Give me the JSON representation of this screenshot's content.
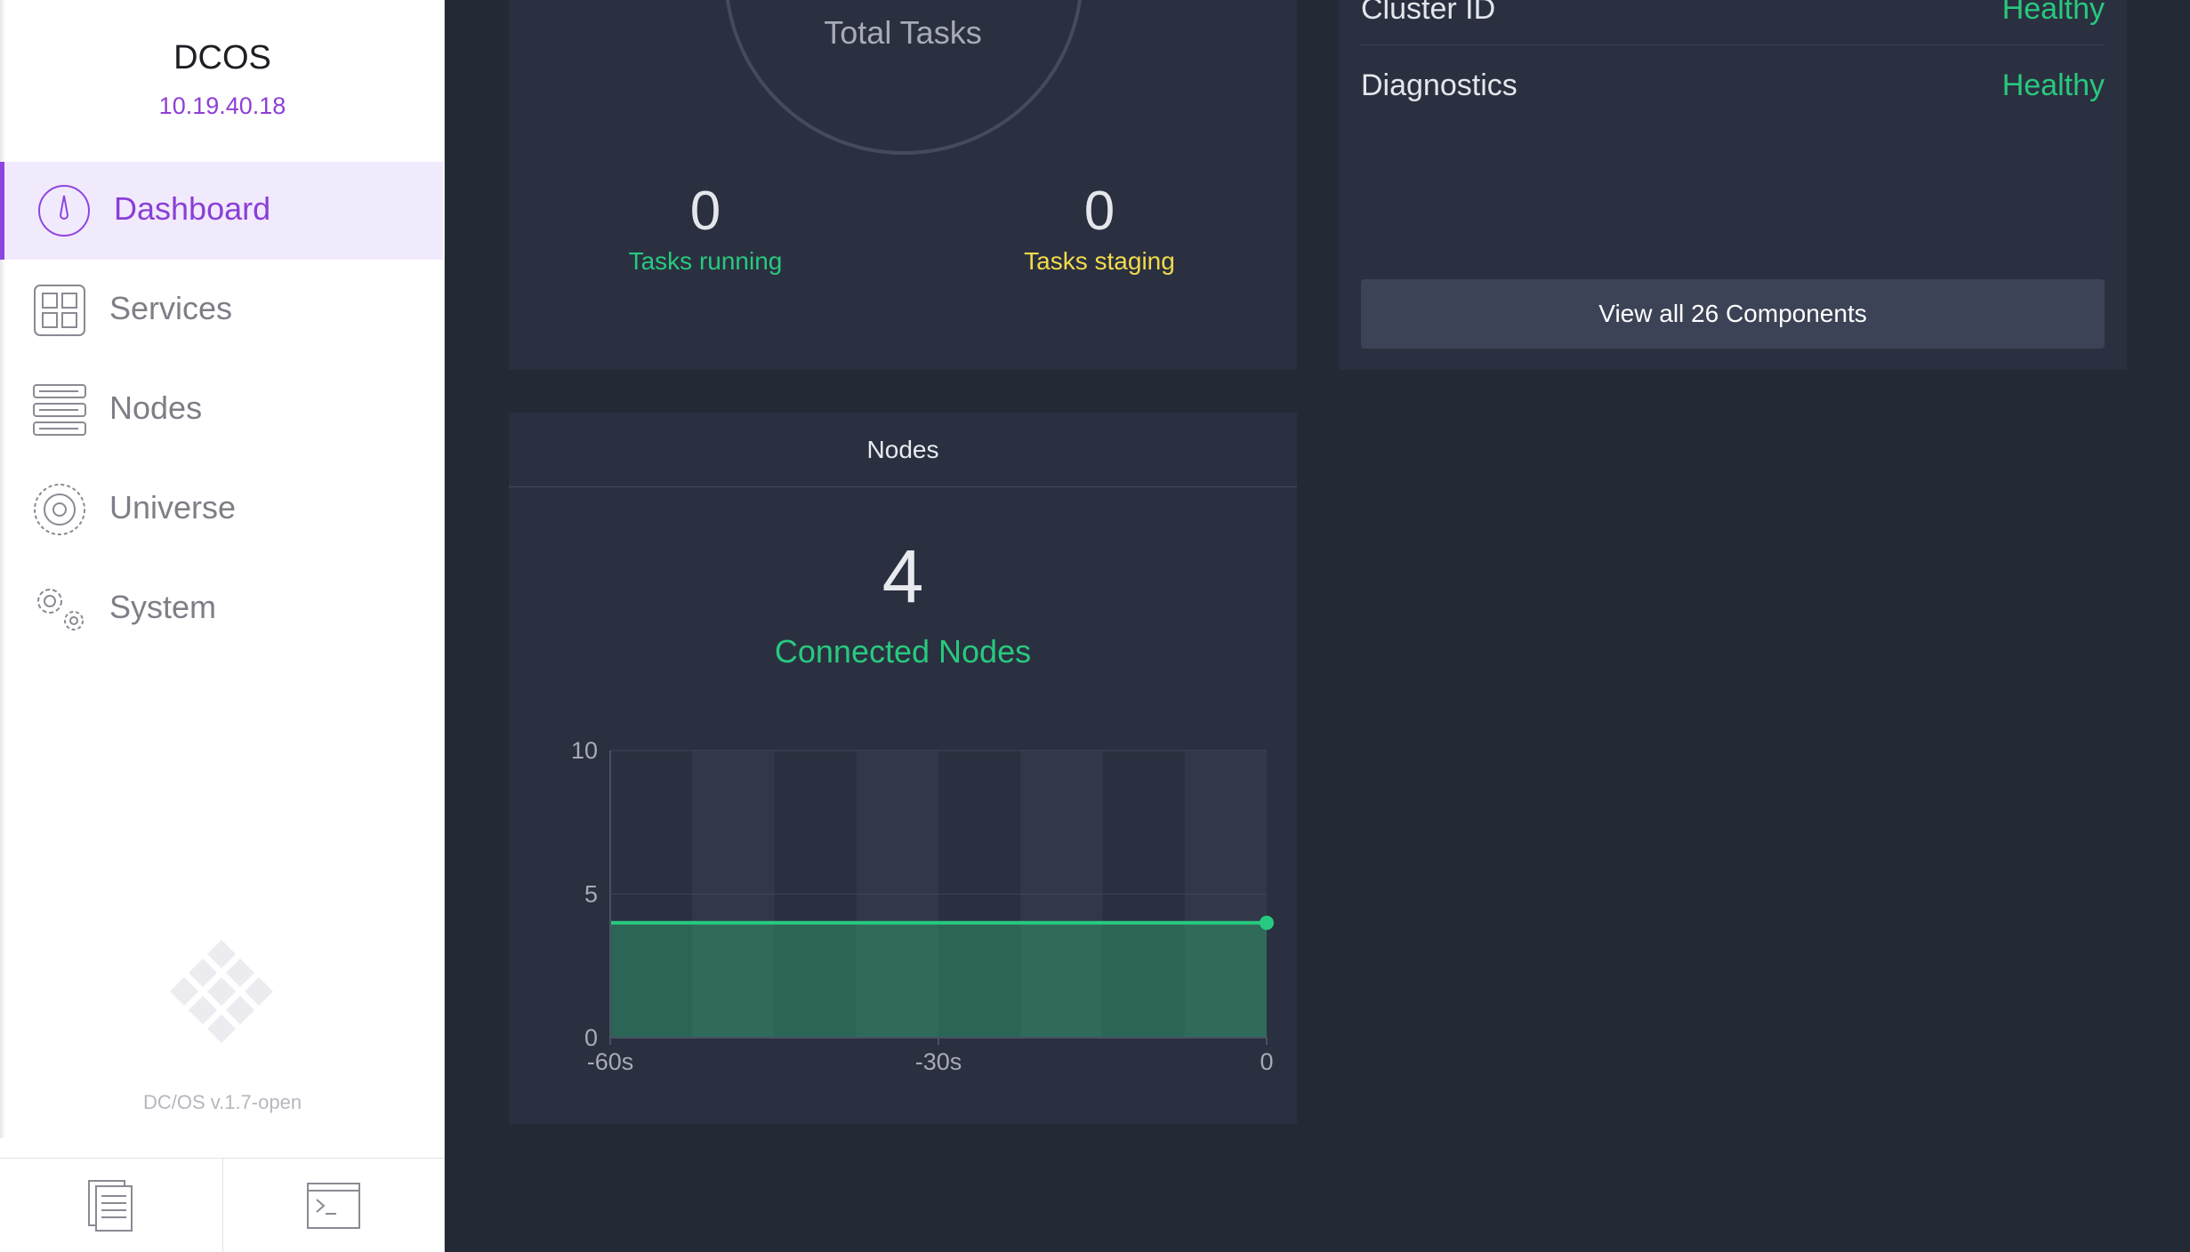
{
  "sidebar": {
    "cluster_name": "DCOS",
    "cluster_ip": "10.19.40.18",
    "items": [
      {
        "label": "Dashboard",
        "icon": "dashboard-icon",
        "active": true
      },
      {
        "label": "Services",
        "icon": "services-icon",
        "active": false
      },
      {
        "label": "Nodes",
        "icon": "nodes-icon",
        "active": false
      },
      {
        "label": "Universe",
        "icon": "universe-icon",
        "active": false
      },
      {
        "label": "System",
        "icon": "system-icon",
        "active": false
      }
    ],
    "version": "DC/OS v.1.7-open",
    "footer_icons": [
      "documentation-icon",
      "cli-icon"
    ]
  },
  "colors": {
    "accent": "#8e44e0",
    "healthy": "#27c97e",
    "staging": "#f2db4c",
    "background": "#242936",
    "panel": "#2b3040"
  },
  "tasks_panel": {
    "donut_label": "Total Tasks",
    "running_count": "0",
    "running_label": "Tasks running",
    "staging_count": "0",
    "staging_label": "Tasks staging"
  },
  "components_panel": {
    "rows": [
      {
        "name": "Cluster ID",
        "status": "Healthy"
      },
      {
        "name": "Diagnostics",
        "status": "Healthy"
      }
    ],
    "view_all_label": "View all 26 Components"
  },
  "nodes_panel": {
    "heading": "Nodes",
    "count": "4",
    "caption": "Connected Nodes"
  },
  "chart_data": {
    "type": "area",
    "title": "",
    "xlabel": "",
    "ylabel": "",
    "x": [
      -60,
      -55,
      -50,
      -45,
      -40,
      -35,
      -30,
      -25,
      -20,
      -15,
      -10,
      -5,
      0
    ],
    "series": [
      {
        "values": [
          4,
          4,
          4,
          4,
          4,
          4,
          4,
          4,
          4,
          4,
          4,
          4,
          4
        ]
      }
    ],
    "xlim": [
      -60,
      0
    ],
    "ylim": [
      0,
      10
    ],
    "x_ticks": [
      -60,
      -30,
      0
    ],
    "x_tick_labels": [
      "-60s",
      "-30s",
      "0"
    ],
    "y_ticks": [
      0,
      5,
      10
    ],
    "y_tick_labels": [
      "0",
      "5",
      "10"
    ],
    "alternating_bands": 8,
    "grid": true,
    "legend": "none"
  }
}
